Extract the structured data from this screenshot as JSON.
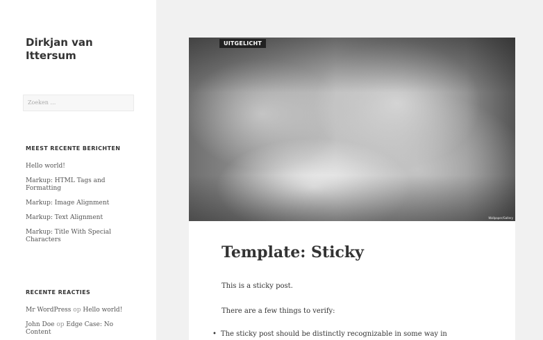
{
  "site": {
    "title": "Dirkjan van Ittersum"
  },
  "search": {
    "placeholder": "Zoeken …"
  },
  "widgets": {
    "recent_posts": {
      "title": "MEEST RECENTE BERICHTEN",
      "items": [
        "Hello world!",
        "Markup: HTML Tags and Formatting",
        "Markup: Image Alignment",
        "Markup: Text Alignment",
        "Markup: Title With Special Characters"
      ]
    },
    "recent_comments": {
      "title": "RECENTE REACTIES",
      "items": [
        {
          "author": "Mr WordPress",
          "sep": "op",
          "post": "Hello world!"
        },
        {
          "author": "John Doe",
          "sep": "op",
          "post": "Edge Case: No Content"
        }
      ]
    }
  },
  "article": {
    "badge": "UITGELICHT",
    "image_credit": "Wallpaper/Gallery",
    "title": "Template: Sticky",
    "paragraphs": [
      "This is a sticky post.",
      "There are a few things to verify:"
    ],
    "list": [
      "The sticky post should be distinctly recognizable in some way in"
    ]
  }
}
